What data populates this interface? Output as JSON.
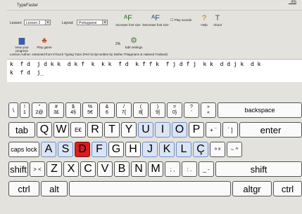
{
  "window": {
    "title": "TypeFaster",
    "extra_link": "_ins"
  },
  "toolbar": {
    "lesson_label": "Lesson:",
    "lesson_value": "Lesson 2",
    "layout_label": "Layout:",
    "layout_value": "Portuguese",
    "increase_font": "Increase font size",
    "decrease_font": "Decrease font size",
    "play_sounds": "Play sounds",
    "help": "Help",
    "about": "About",
    "view_progress": "View your progress",
    "play_game": "Play game",
    "percent": "2%",
    "edit_settings": "Edit settings"
  },
  "author_line": "Lesson Author: extracted from KTouch Typing Tutor (Perl Script written by Stefan Thiagmann & Hakeed Fasland)",
  "text_lines": [
    "k  f d  j d k k  d k f  k  k k  f d  k f f k  f j d f j  k k  d d j k  d k",
    "k  f d  j_"
  ],
  "keyboard": {
    "row1": [
      {
        "top": "",
        "bot": "\\"
      },
      {
        "top": "!",
        "bot": "1"
      },
      {
        "top": "\"",
        "bot": "2@"
      },
      {
        "top": "#",
        "bot": "3£"
      },
      {
        "top": "$",
        "bot": "4§"
      },
      {
        "top": "%",
        "bot": "5€"
      },
      {
        "top": "&",
        "bot": "6"
      },
      {
        "top": "/",
        "bot": "7{"
      },
      {
        "top": "(",
        "bot": "8["
      },
      {
        "top": ")",
        "bot": "9]"
      },
      {
        "top": "=",
        "bot": "0}"
      },
      {
        "top": "?",
        "bot": "'"
      },
      {
        "top": "»",
        "bot": "«"
      },
      {
        "label": "backspace"
      }
    ],
    "row2": [
      "tab",
      "Q",
      "W",
      "E€",
      "R",
      "T",
      "Y",
      "U",
      "I",
      "O",
      "P",
      "+ ¨",
      "´ ]",
      "enter"
    ],
    "row3": [
      "caps lock",
      "A",
      "S",
      "D",
      "F",
      "G",
      "H",
      "J",
      "K",
      "L",
      "Ç",
      "º ª",
      "~ ^"
    ],
    "row4": [
      "shift",
      "> <",
      "Z",
      "X",
      "C",
      "V",
      "B",
      "N",
      "M",
      "; ,",
      ": .",
      "_ -",
      "shift"
    ],
    "row5": [
      "ctrl",
      "alt",
      "altgr",
      "ctrl"
    ]
  }
}
